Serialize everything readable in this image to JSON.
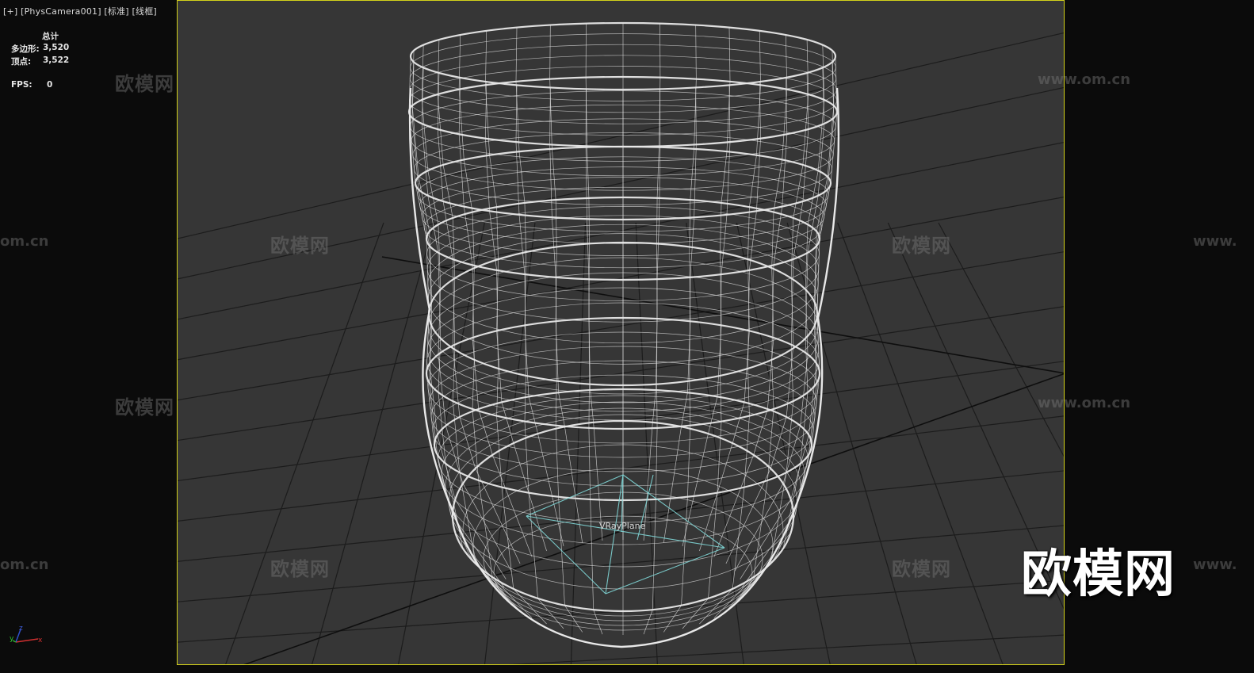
{
  "viewport": {
    "label_plus": "[+]",
    "label_camera": "[PhysCamera001]",
    "label_shading": "[标准]",
    "label_mode": "[线框]"
  },
  "stats": {
    "header": "总计",
    "polygons_label": "多边形:",
    "polygons_value": "3,520",
    "vertices_label": "顶点:",
    "vertices_value": "3,522",
    "fps_label": "FPS:",
    "fps_value": "0"
  },
  "object_label": "VRayPlane",
  "watermarks": {
    "brand": "欧模网",
    "url": "www.om.cn",
    "url_partial_left": "om.cn",
    "url_partial_right": "www."
  },
  "axis": {
    "x": "x",
    "y": "y",
    "z": "z"
  },
  "colors": {
    "frame_border": "#d4d21a",
    "viewport_bg": "#363636",
    "outer_bg": "#0b0b0b",
    "wire": "#e8e8e8",
    "grid": "#1c1c1c",
    "plane": "#7fd6d6"
  }
}
